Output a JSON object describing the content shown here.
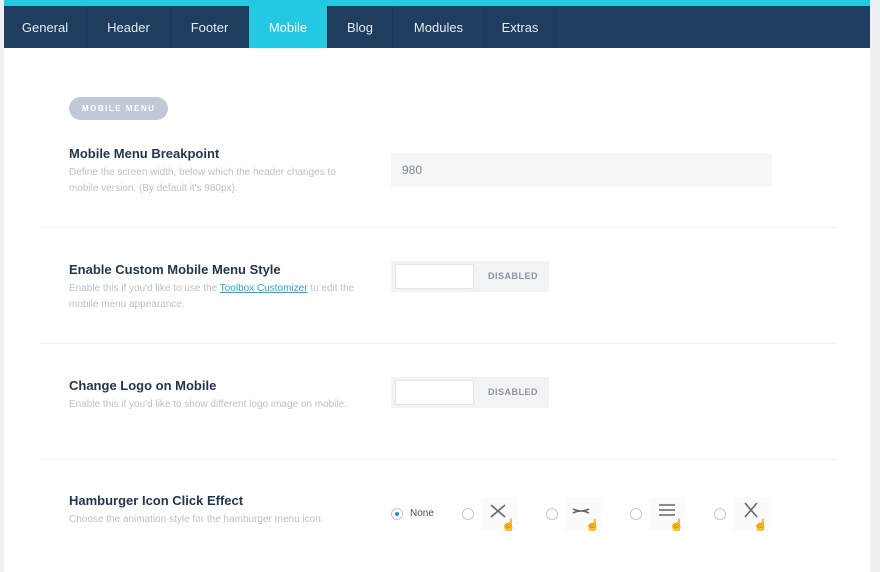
{
  "tabs": [
    {
      "label": "General"
    },
    {
      "label": "Header"
    },
    {
      "label": "Footer"
    },
    {
      "label": "Mobile",
      "active": true
    },
    {
      "label": "Blog"
    },
    {
      "label": "Modules"
    },
    {
      "label": "Extras"
    }
  ],
  "section_badge": "MOBILE MENU",
  "breakpoint": {
    "title": "Mobile Menu Breakpoint",
    "desc": "Define the screen width, below which the header changes to mobile version. (By default it's 980px).",
    "value": "980"
  },
  "custom_style": {
    "title": "Enable Custom Mobile Menu Style",
    "desc_pre": "Enable this if you'd like to use the ",
    "link": "Toolbox Customizer",
    "desc_post": " to edit the mobile menu appearance.",
    "state": "DISABLED"
  },
  "logo": {
    "title": "Change Logo on Mobile",
    "desc": "Enable this if you'd like to show different logo image on mobile.",
    "state": "DISABLED"
  },
  "hamburger": {
    "title": "Hamburger Icon Click Effect",
    "desc": "Choose the animation style for the hamburger menu icon.",
    "none_label": "None",
    "selected": "None"
  }
}
